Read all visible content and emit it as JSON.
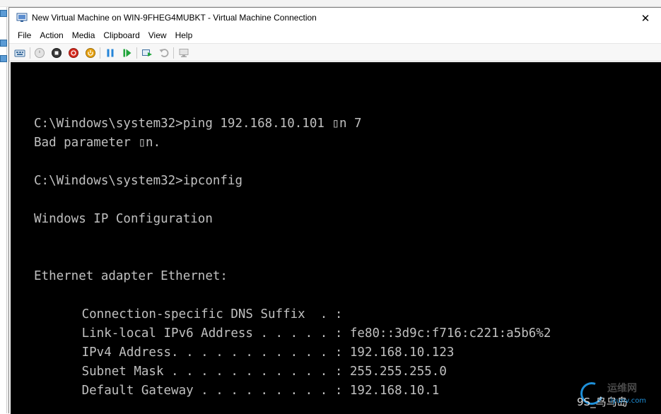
{
  "window": {
    "title": "New Virtual Machine on WIN-9FHEG4MUBKT - Virtual Machine Connection",
    "close_glyph": "✕"
  },
  "menu": {
    "items": [
      "File",
      "Action",
      "Media",
      "Clipboard",
      "View",
      "Help"
    ]
  },
  "toolbar": {
    "buttons": [
      {
        "icon": "ctrl-alt-del-icon",
        "enabled": true
      },
      {
        "icon": "start-icon",
        "enabled": false
      },
      {
        "icon": "turn-off-icon",
        "enabled": true
      },
      {
        "icon": "shut-down-icon",
        "enabled": true
      },
      {
        "icon": "save-icon",
        "enabled": true
      },
      {
        "icon": "pause-icon",
        "enabled": true
      },
      {
        "icon": "reset-icon",
        "enabled": true
      },
      {
        "icon": "checkpoint-icon",
        "enabled": true
      },
      {
        "icon": "revert-icon",
        "enabled": false
      },
      {
        "icon": "enhanced-session-icon",
        "enabled": false
      }
    ]
  },
  "console": {
    "lines": [
      "C:\\Windows\\system32>ping 192.168.10.101 ▯n 7",
      "Bad parameter ▯n.",
      "",
      "C:\\Windows\\system32>ipconfig",
      "",
      "Windows IP Configuration",
      "",
      "",
      "Ethernet adapter Ethernet:",
      "",
      "   Connection-specific DNS Suffix  . :",
      "   Link-local IPv6 Address . . . . . : fe80::3d9c:f716:c221:a5b6%2",
      "   IPv4 Address. . . . . . . . . . . : 192.168.10.123",
      "   Subnet Mask . . . . . . . . . . . : 255.255.255.0",
      "   Default Gateway . . . . . . . . . : 192.168.10.1"
    ]
  },
  "watermark": {
    "top_text": "运维网",
    "bottom_text": "9S_鸟乌岛",
    "sub_text": "iyunv.com"
  },
  "colors": {
    "console_bg": "#000000",
    "console_fg": "#c0c0c0",
    "toolbar_bg": "#f7f7f7",
    "accent_blue": "#1e8fd8"
  }
}
